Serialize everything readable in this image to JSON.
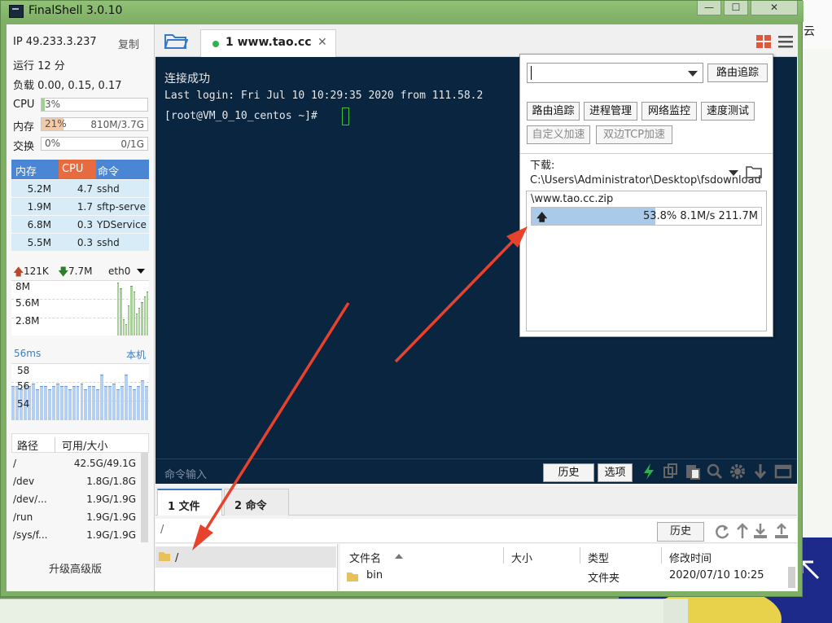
{
  "window": {
    "title": "FinalShell 3.0.10",
    "min_label": "—",
    "max_label": "☐",
    "close_label": "✕"
  },
  "background": {
    "right_text": "云"
  },
  "sysinfo": {
    "ip": "IP 49.233.3.237",
    "copy": "复制",
    "uptime": "运行 12 分",
    "load": "负载 0.00, 0.15, 0.17",
    "cpu_label": "CPU",
    "cpu_value": "3%",
    "cpu_fraction": 0.03,
    "mem_label": "内存",
    "mem_value": "21%",
    "mem_detail": "810M/3.7G",
    "mem_fraction": 0.21,
    "swap_label": "交换",
    "swap_value": "0%",
    "swap_detail": "0/1G",
    "swap_fraction": 0.0
  },
  "processes": {
    "headers": [
      "内存",
      "CPU",
      "命令"
    ],
    "rows": [
      {
        "mem": "5.2M",
        "cpu": "4.7",
        "cmd": "sshd"
      },
      {
        "mem": "1.9M",
        "cpu": "1.7",
        "cmd": "sftp-serve"
      },
      {
        "mem": "6.8M",
        "cpu": "0.3",
        "cmd": "YDService"
      },
      {
        "mem": "5.5M",
        "cpu": "0.3",
        "cmd": "sshd"
      }
    ]
  },
  "network": {
    "up": "121K",
    "down": "7.7M",
    "iface": "eth0",
    "y_labels": [
      "8M",
      "5.6M",
      "2.8M"
    ],
    "bars": [
      0,
      0,
      0,
      0,
      0,
      0,
      0,
      0,
      0,
      0,
      0,
      0,
      0,
      0,
      0,
      0,
      0,
      0,
      0,
      0,
      0,
      0,
      0,
      0,
      0,
      0,
      0,
      0,
      0,
      0,
      0,
      0,
      0,
      0,
      0,
      0,
      0,
      0,
      0,
      0,
      0.95,
      0.85,
      0.3,
      0.2,
      0.55,
      0.9,
      0.8,
      0.4,
      0.5,
      0.6,
      0.7,
      0.8
    ]
  },
  "latency": {
    "label": "56ms",
    "host": "本机",
    "y_labels": [
      "58",
      "56",
      "54"
    ],
    "bars": [
      0.6,
      0.6,
      0.55,
      0.6,
      0.6,
      0.65,
      0.55,
      0.6,
      0.6,
      0.55,
      0.6,
      0.65,
      0.6,
      0.6,
      0.55,
      0.6,
      0.6,
      0.65,
      0.55,
      0.6,
      0.6,
      0.55,
      0.8,
      0.6,
      0.6,
      0.65,
      0.55,
      0.6,
      0.8,
      0.6,
      0.55,
      0.6,
      0.7,
      0.6
    ]
  },
  "disks": {
    "headers": [
      "路径",
      "可用/大小"
    ],
    "rows": [
      {
        "path": "/",
        "size": "42.5G/49.1G"
      },
      {
        "path": "/dev",
        "size": "1.8G/1.8G"
      },
      {
        "path": "/dev/...",
        "size": "1.9G/1.9G"
      },
      {
        "path": "/run",
        "size": "1.9G/1.9G"
      },
      {
        "path": "/sys/f...",
        "size": "1.9G/1.9G"
      }
    ]
  },
  "upgrade": "升级高级版",
  "session_tab": {
    "label": "1 www.tao.cc",
    "close": "✕"
  },
  "terminal": {
    "lines": [
      "连接成功",
      "Last login: Fri Jul 10 10:29:35 2020 from 111.58.2",
      "[root@VM_0_10_centos ~]#"
    ],
    "cmd_placeholder": "命令输入",
    "history": "历史",
    "options": "选项"
  },
  "popup": {
    "route_trace": "路由追踪",
    "buttons": [
      "路由追踪",
      "进程管理",
      "网络监控",
      "速度测试"
    ],
    "disabled_buttons": [
      "自定义加速",
      "双边TCP加速"
    ],
    "download_path": "下载: C:\\Users\\Administrator\\Desktop\\fsdownload",
    "file": "\\www.tao.cc.zip",
    "progress_text": "53.8% 8.1M/s 211.7M",
    "progress_fraction": 0.538,
    "up_glyph": "🡅"
  },
  "files": {
    "tabs": [
      "1 文件",
      "2 命令"
    ],
    "path": "/",
    "history": "历史",
    "tree_root": "/",
    "columns": [
      "文件名",
      "大小",
      "类型",
      "修改时间"
    ],
    "rows": [
      {
        "name": "bin",
        "size": "",
        "type": "文件夹",
        "mtime": "2020/07/10 10:25"
      }
    ]
  },
  "colors": {
    "accent": "#4a86d4",
    "terminal_bg": "#0a2540",
    "arrow": "#e8412c"
  }
}
